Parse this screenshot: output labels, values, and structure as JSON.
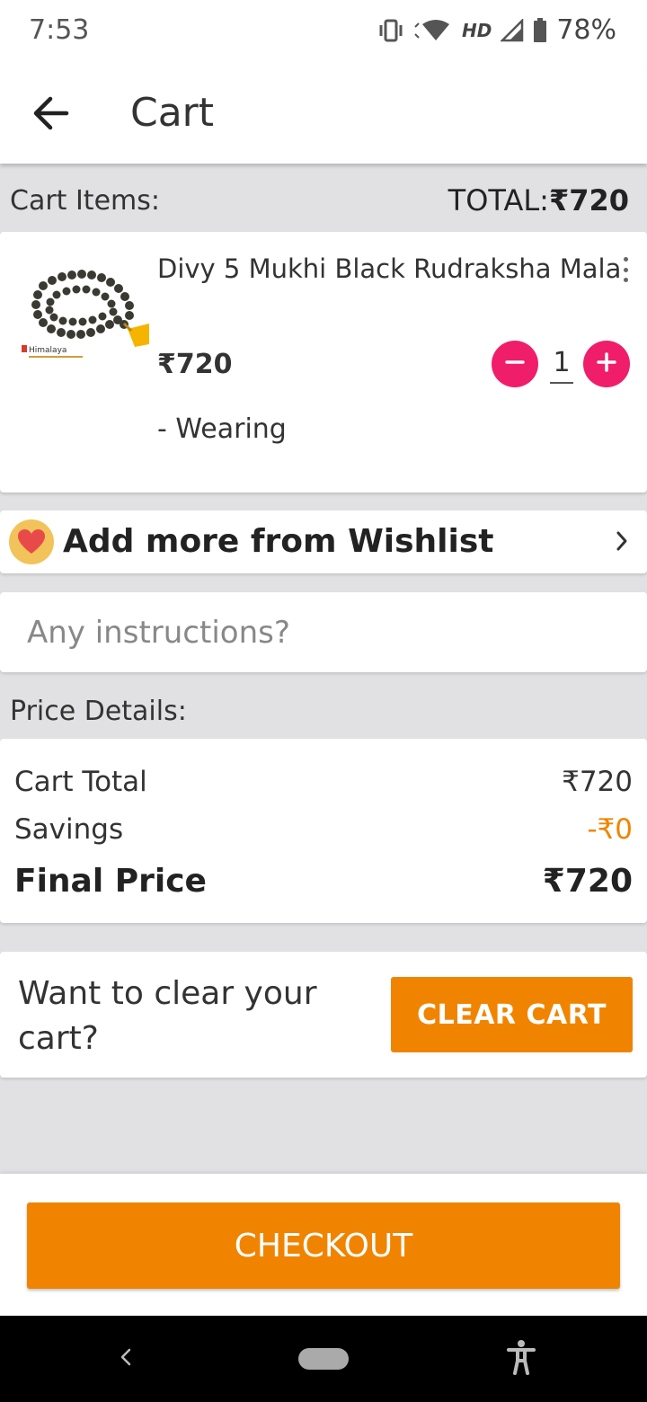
{
  "status_bar": {
    "time": "7:53",
    "network_label": "HD",
    "battery": "78%"
  },
  "app_bar": {
    "title": "Cart"
  },
  "cart": {
    "items_label": "Cart Items:",
    "total_label": "TOTAL:",
    "total_value": "₹720",
    "items": [
      {
        "name": "Divy 5 Mukhi Black Rudraksha Mala",
        "price": "₹720",
        "quantity": "1",
        "variant": "- Wearing",
        "thumbnail_brand": "Himalaya"
      }
    ]
  },
  "wishlist": {
    "label": "Add more from Wishlist"
  },
  "instructions": {
    "placeholder": "Any instructions?"
  },
  "price_details": {
    "label": "Price Details:",
    "cart_total_label": "Cart Total",
    "cart_total_value": "₹720",
    "savings_label": "Savings",
    "savings_value": "-₹0",
    "final_price_label": "Final Price",
    "final_price_value": "₹720"
  },
  "clear_cart": {
    "prompt": "Want to clear your cart?",
    "button_label": "CLEAR CART"
  },
  "checkout": {
    "button_label": "CHECKOUT"
  },
  "colors": {
    "accent": "#f08400",
    "qty_button": "#f01d6a",
    "savings": "#f08400"
  }
}
